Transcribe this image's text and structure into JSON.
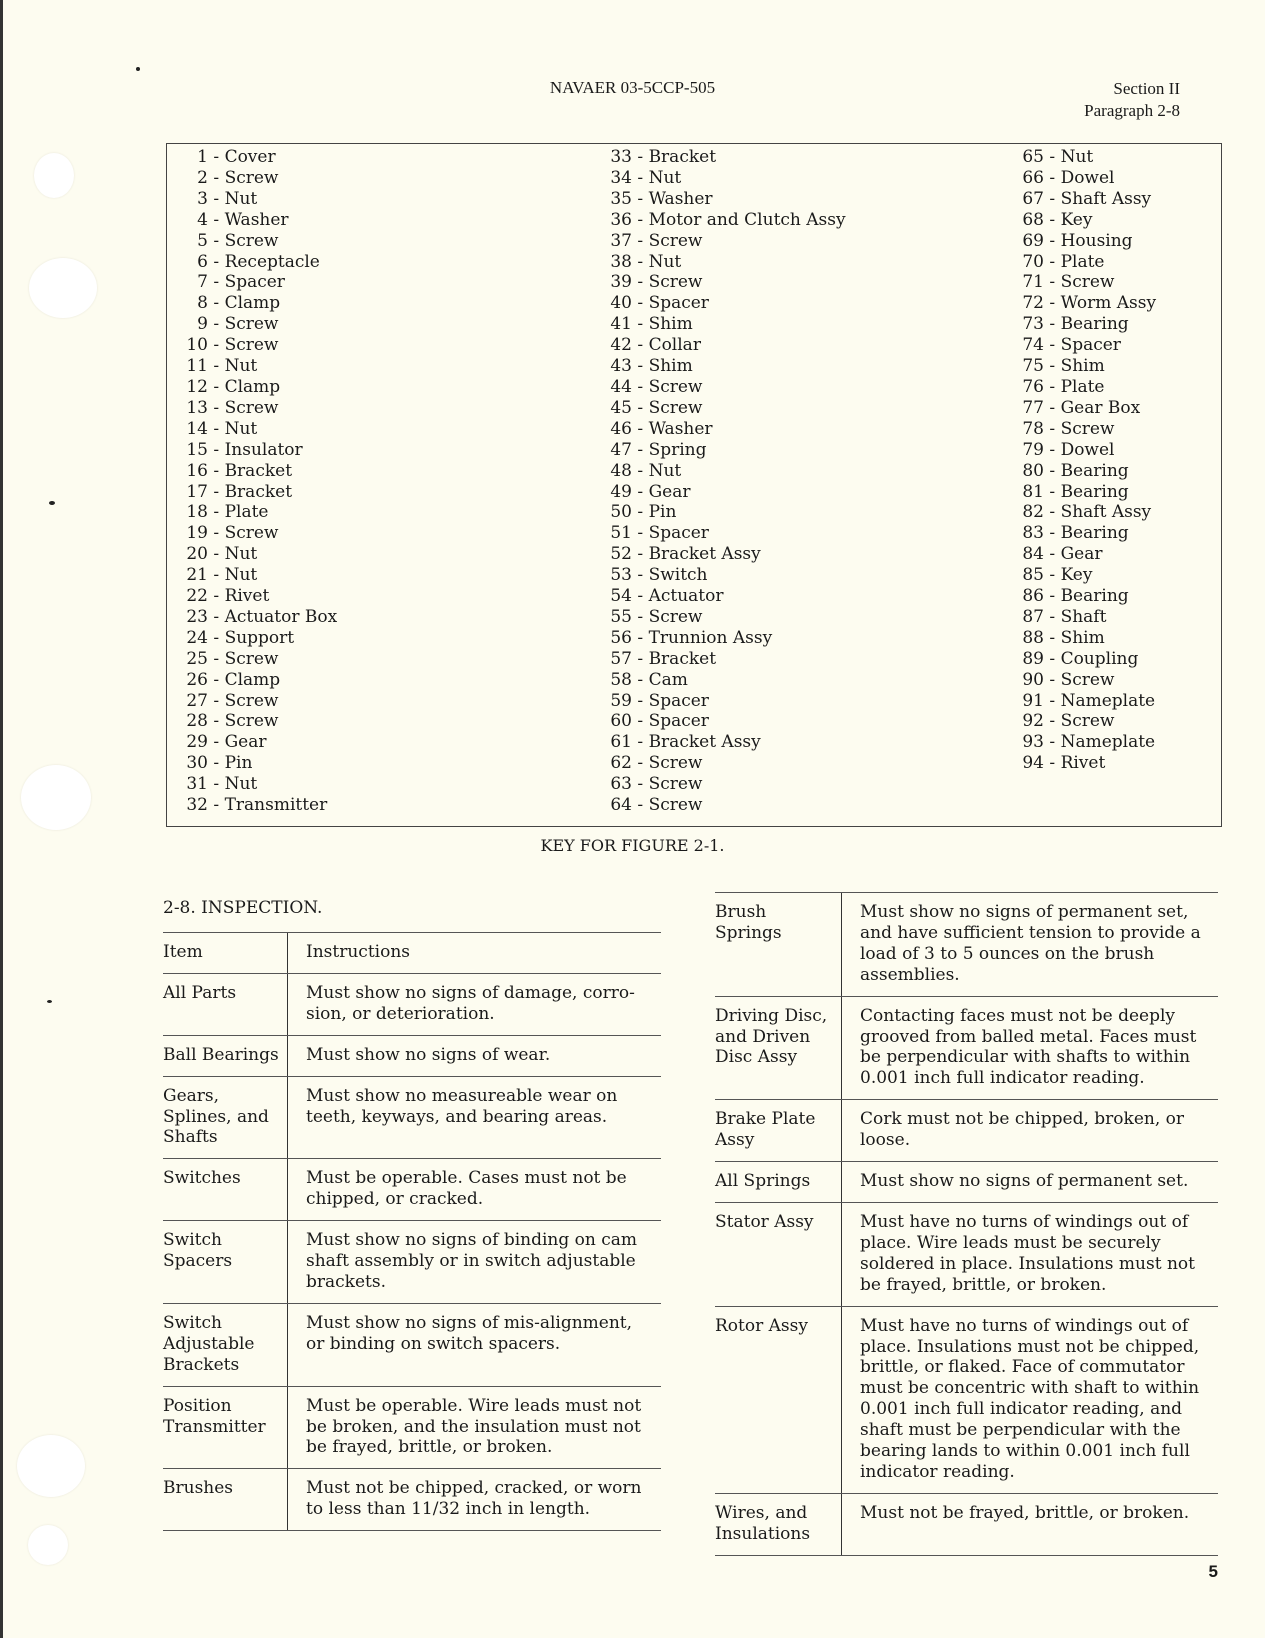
{
  "header": {
    "doc_number": "NAVAER 03-5CCP-505",
    "section": "Section II",
    "paragraph": "Paragraph 2-8"
  },
  "key": {
    "caption": "KEY FOR FIGURE 2-1.",
    "columns": [
      [
        {
          "n": "1",
          "name": "Cover"
        },
        {
          "n": "2",
          "name": "Screw"
        },
        {
          "n": "3",
          "name": "Nut"
        },
        {
          "n": "4",
          "name": "Washer"
        },
        {
          "n": "5",
          "name": "Screw"
        },
        {
          "n": "6",
          "name": "Receptacle"
        },
        {
          "n": "7",
          "name": "Spacer"
        },
        {
          "n": "8",
          "name": "Clamp"
        },
        {
          "n": "9",
          "name": "Screw"
        },
        {
          "n": "10",
          "name": "Screw"
        },
        {
          "n": "11",
          "name": "Nut"
        },
        {
          "n": "12",
          "name": "Clamp"
        },
        {
          "n": "13",
          "name": "Screw"
        },
        {
          "n": "14",
          "name": "Nut"
        },
        {
          "n": "15",
          "name": "Insulator"
        },
        {
          "n": "16",
          "name": "Bracket"
        },
        {
          "n": "17",
          "name": "Bracket"
        },
        {
          "n": "18",
          "name": "Plate"
        },
        {
          "n": "19",
          "name": "Screw"
        },
        {
          "n": "20",
          "name": "Nut"
        },
        {
          "n": "21",
          "name": "Nut"
        },
        {
          "n": "22",
          "name": "Rivet"
        },
        {
          "n": "23",
          "name": "Actuator Box"
        },
        {
          "n": "24",
          "name": "Support"
        },
        {
          "n": "25",
          "name": "Screw"
        },
        {
          "n": "26",
          "name": "Clamp"
        },
        {
          "n": "27",
          "name": "Screw"
        },
        {
          "n": "28",
          "name": "Screw"
        },
        {
          "n": "29",
          "name": "Gear"
        },
        {
          "n": "30",
          "name": "Pin"
        },
        {
          "n": "31",
          "name": "Nut"
        },
        {
          "n": "32",
          "name": "Transmitter"
        }
      ],
      [
        {
          "n": "33",
          "name": "Bracket"
        },
        {
          "n": "34",
          "name": "Nut"
        },
        {
          "n": "35",
          "name": "Washer"
        },
        {
          "n": "36",
          "name": "Motor and Clutch Assy"
        },
        {
          "n": "37",
          "name": "Screw"
        },
        {
          "n": "38",
          "name": "Nut"
        },
        {
          "n": "39",
          "name": "Screw"
        },
        {
          "n": "40",
          "name": "Spacer"
        },
        {
          "n": "41",
          "name": "Shim"
        },
        {
          "n": "42",
          "name": "Collar"
        },
        {
          "n": "43",
          "name": "Shim"
        },
        {
          "n": "44",
          "name": "Screw"
        },
        {
          "n": "45",
          "name": "Screw"
        },
        {
          "n": "46",
          "name": "Washer"
        },
        {
          "n": "47",
          "name": "Spring"
        },
        {
          "n": "48",
          "name": "Nut"
        },
        {
          "n": "49",
          "name": "Gear"
        },
        {
          "n": "50",
          "name": "Pin"
        },
        {
          "n": "51",
          "name": "Spacer"
        },
        {
          "n": "52",
          "name": "Bracket Assy"
        },
        {
          "n": "53",
          "name": "Switch"
        },
        {
          "n": "54",
          "name": "Actuator"
        },
        {
          "n": "55",
          "name": "Screw"
        },
        {
          "n": "56",
          "name": "Trunnion Assy"
        },
        {
          "n": "57",
          "name": "Bracket"
        },
        {
          "n": "58",
          "name": "Cam"
        },
        {
          "n": "59",
          "name": "Spacer"
        },
        {
          "n": "60",
          "name": "Spacer"
        },
        {
          "n": "61",
          "name": "Bracket Assy"
        },
        {
          "n": "62",
          "name": "Screw"
        },
        {
          "n": "63",
          "name": "Screw"
        },
        {
          "n": "64",
          "name": "Screw"
        }
      ],
      [
        {
          "n": "65",
          "name": "Nut"
        },
        {
          "n": "66",
          "name": "Dowel"
        },
        {
          "n": "67",
          "name": "Shaft Assy"
        },
        {
          "n": "68",
          "name": "Key"
        },
        {
          "n": "69",
          "name": "Housing"
        },
        {
          "n": "70",
          "name": "Plate"
        },
        {
          "n": "71",
          "name": "Screw"
        },
        {
          "n": "72",
          "name": "Worm Assy"
        },
        {
          "n": "73",
          "name": "Bearing"
        },
        {
          "n": "74",
          "name": "Spacer"
        },
        {
          "n": "75",
          "name": "Shim"
        },
        {
          "n": "76",
          "name": "Plate"
        },
        {
          "n": "77",
          "name": "Gear Box"
        },
        {
          "n": "78",
          "name": "Screw"
        },
        {
          "n": "79",
          "name": "Dowel"
        },
        {
          "n": "80",
          "name": "Bearing"
        },
        {
          "n": "81",
          "name": "Bearing"
        },
        {
          "n": "82",
          "name": "Shaft Assy"
        },
        {
          "n": "83",
          "name": "Bearing"
        },
        {
          "n": "84",
          "name": "Gear"
        },
        {
          "n": "85",
          "name": "Key"
        },
        {
          "n": "86",
          "name": "Bearing"
        },
        {
          "n": "87",
          "name": "Shaft"
        },
        {
          "n": "88",
          "name": "Shim"
        },
        {
          "n": "89",
          "name": "Coupling"
        },
        {
          "n": "90",
          "name": "Screw"
        },
        {
          "n": "91",
          "name": "Nameplate"
        },
        {
          "n": "92",
          "name": "Screw"
        },
        {
          "n": "93",
          "name": "Nameplate"
        },
        {
          "n": "94",
          "name": "Rivet"
        }
      ]
    ]
  },
  "inspection": {
    "title": "2-8.  INSPECTION.",
    "header": {
      "item": "Item",
      "instructions": "Instructions"
    },
    "left_rows": [
      {
        "item": "All Parts",
        "text": "Must show no signs of damage, corro-sion, or deterioration."
      },
      {
        "item": "Ball Bearings",
        "text": "Must show no signs of wear."
      },
      {
        "item": "Gears, Splines, and Shafts",
        "text": "Must show no measureable wear on teeth, keyways, and bearing areas."
      },
      {
        "item": "Switches",
        "text": "Must be operable.  Cases must not be chipped, or cracked."
      },
      {
        "item": "Switch Spacers",
        "text": "Must show no signs of binding on cam shaft assembly or in switch adjustable brackets."
      },
      {
        "item": "Switch Adjustable Brackets",
        "text": "Must show no signs of mis-alignment, or binding on switch spacers."
      },
      {
        "item": "Position Transmitter",
        "text": "Must be operable.  Wire leads must not be broken, and the insulation must not be frayed, brittle, or broken."
      },
      {
        "item": "Brushes",
        "text": "Must not be chipped, cracked, or worn to less than 11/32 inch in length."
      }
    ],
    "right_rows": [
      {
        "item": "Brush Springs",
        "text": "Must show no signs of permanent set, and have sufficient tension to provide a load of 3 to 5 ounces on the brush assemblies."
      },
      {
        "item": "Driving Disc, and Driven Disc Assy",
        "text": "Contacting faces must not be deeply grooved from balled metal.  Faces must be perpendicular with shafts to within 0.001 inch full indicator reading."
      },
      {
        "item": "Brake Plate Assy",
        "text": "Cork must not be chipped, broken, or loose."
      },
      {
        "item": "All Springs",
        "text": "Must show no signs of permanent set."
      },
      {
        "item": "Stator Assy",
        "text": "Must have no turns of windings out of place.  Wire leads must be securely soldered in place.  Insulations must not be frayed, brittle, or broken."
      },
      {
        "item": "Rotor Assy",
        "text": "Must have no turns of windings out of place.  Insulations must not be chipped, brittle, or flaked.  Face of commutator must be concentric with shaft to within 0.001 inch full indicator reading, and shaft must be perpendicular with the bearing lands to within 0.001 inch full indicator reading."
      },
      {
        "item": "Wires, and Insulations",
        "text": "Must not be frayed, brittle, or broken."
      }
    ]
  },
  "footer": {
    "page_number": "5"
  }
}
